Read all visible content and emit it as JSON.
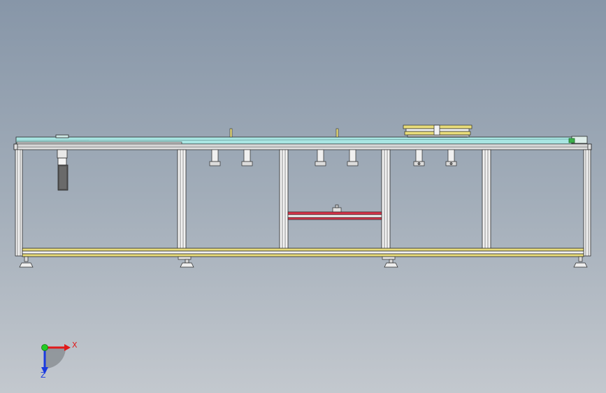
{
  "view": {
    "background_top": "#8796a8",
    "background_bottom": "#c3c8ce",
    "frame_color": "#f2f2f2",
    "edge_color": "#2a2a2a",
    "top_plate_color": "#a9e6e3",
    "base_rail_color": "#e8dc7a",
    "cross_beam_color": "#d8334a"
  },
  "triad": {
    "x_label": "X",
    "z_label": "Z",
    "x_color": "#e01a1a",
    "z_color": "#1a3ae0",
    "origin_color": "#22cc22"
  }
}
